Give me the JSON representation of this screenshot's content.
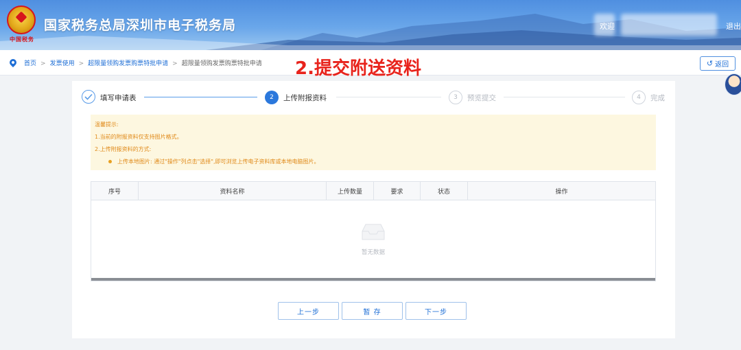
{
  "header": {
    "site_title": "国家税务总局深圳市电子税务局",
    "emblem_text": "中国税务",
    "welcome": "欢迎",
    "logout": "退出"
  },
  "breadcrumb": {
    "items": [
      "首页",
      "发票使用",
      "超限量领购发票购票特批申请",
      "超限量领购发票购票特批申请"
    ]
  },
  "annotation": "2.提交附送资料",
  "back_button": {
    "label": "返回"
  },
  "steps": [
    {
      "number": "1",
      "label": "填写申请表",
      "state": "done"
    },
    {
      "number": "2",
      "label": "上传附报资料",
      "state": "active"
    },
    {
      "number": "3",
      "label": "预览提交",
      "state": "todo"
    },
    {
      "number": "4",
      "label": "完成",
      "state": "todo"
    }
  ],
  "notice": {
    "title": "温馨提示:",
    "line1": "1.当前的附报资料仅支持图片格式。",
    "line2": "2.上传附报资料的方式:",
    "bullet1": "上传本地图片: 通过\"操作\"列点击\"选择\",即可浏览上传电子资料库或本地电脑图片。"
  },
  "table": {
    "columns": [
      "序号",
      "资料名称",
      "上传数量",
      "要求",
      "状态",
      "操作"
    ],
    "empty_text": "暂无数据"
  },
  "buttons": {
    "prev": "上一步",
    "save": "暂 存",
    "next": "下一步"
  },
  "colors": {
    "primary": "#2b78dc",
    "annotation": "#e8231c",
    "notice_bg": "#fdf7e0",
    "notice_text": "#e08a1a"
  }
}
